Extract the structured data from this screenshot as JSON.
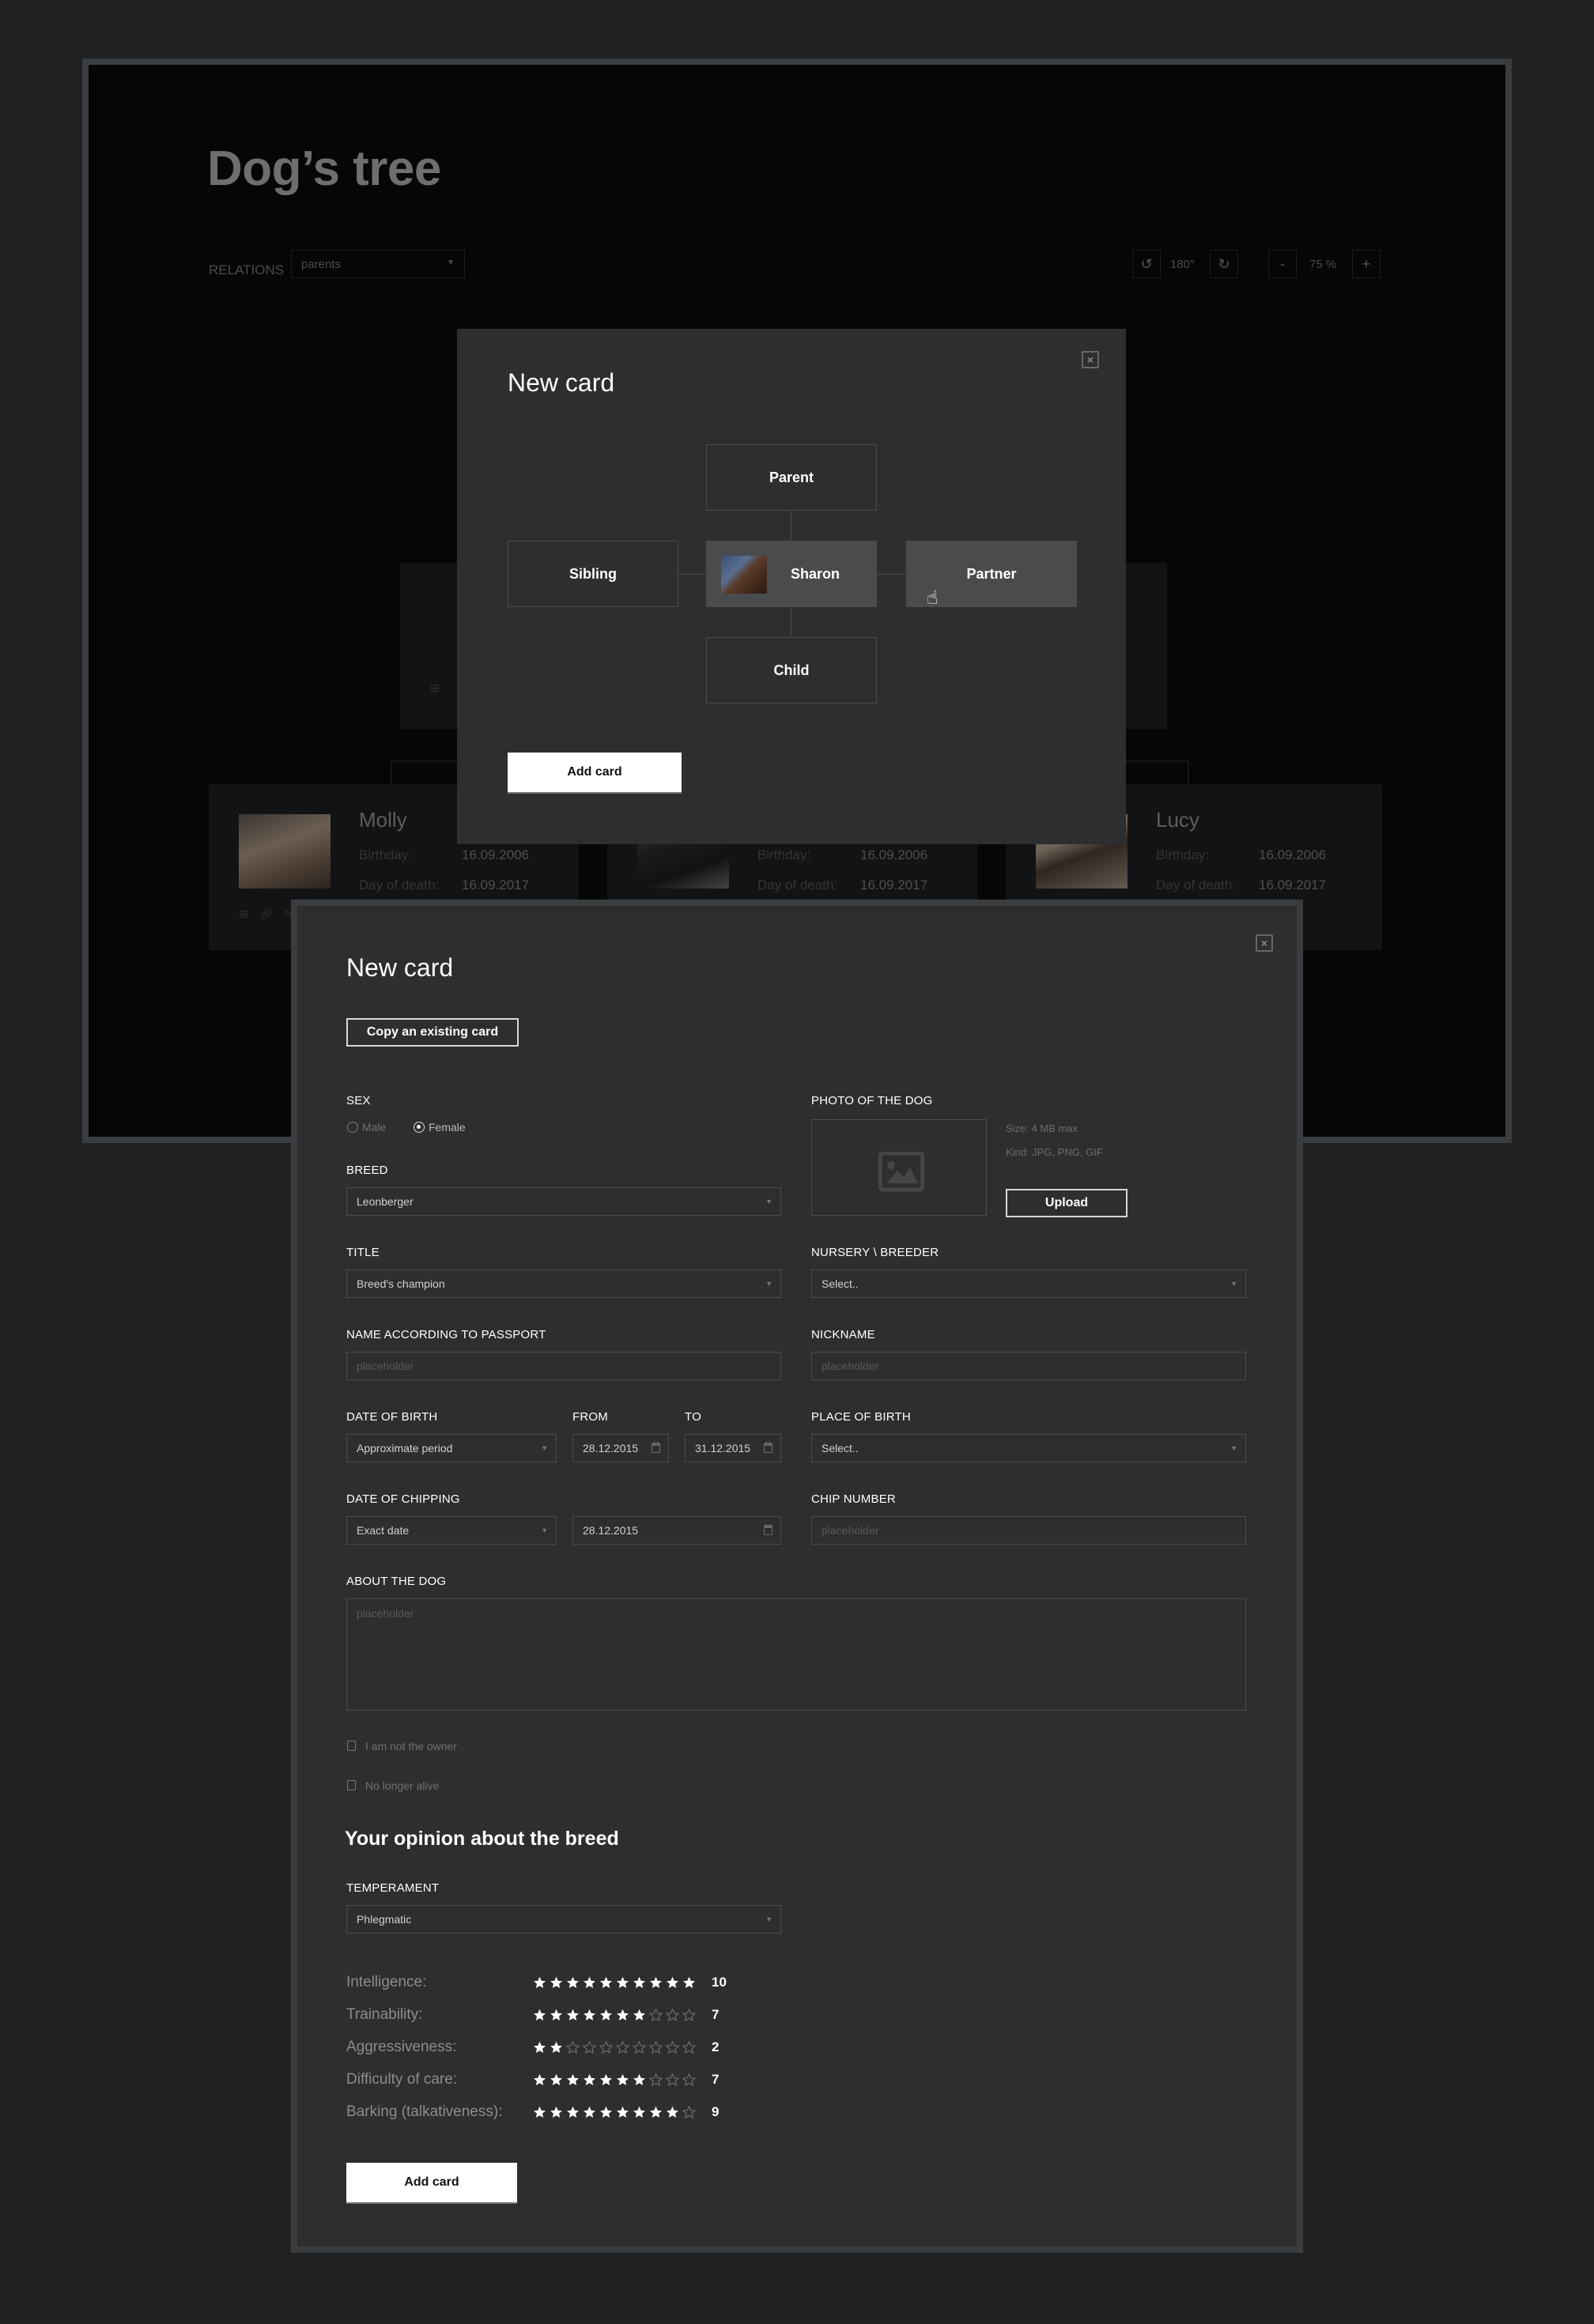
{
  "background_page": {
    "title": "Dog’s tree",
    "relations_label": "RELATIONS",
    "relations_value": "parents",
    "rotation_value": "180°",
    "zoom_value": "75 %",
    "rotate_left_icon": "↺",
    "rotate_right_icon": "↻",
    "zoom_out_label": "-",
    "zoom_in_label": "+",
    "cards": [
      {
        "name": "Molly",
        "birthday_label": "Birthday:",
        "birthday": "16.09.2006",
        "death_label": "Day of death:",
        "death": "16.09.2017"
      },
      {
        "name": "",
        "birthday_label": "Birthday:",
        "birthday": "16.09.2006",
        "death_label": "Day of death:",
        "death": "16.09.2017"
      },
      {
        "name": "Lucy",
        "birthday_label": "Birthday:",
        "birthday": "16.09.2006",
        "death_label": "Day of death:",
        "death": "16.09.2017"
      }
    ]
  },
  "relation_modal": {
    "title": "New card",
    "close_label": "×",
    "parent": "Parent",
    "sibling": "Sibling",
    "current": "Sharon",
    "partner": "Partner",
    "child": "Child",
    "add_button": "Add card"
  },
  "form_modal": {
    "title": "New card",
    "close_label": "×",
    "copy_button": "Copy an existing card",
    "sex": {
      "label": "SEX",
      "options": [
        "Male",
        "Female"
      ],
      "selected": "Female"
    },
    "photo": {
      "label": "PHOTO OF THE DOG",
      "size_hint": "Size: 4 MB max",
      "kind_hint": "Kind: JPG, PNG, GIF",
      "upload_button": "Upload"
    },
    "breed": {
      "label": "BREED",
      "value": "Leonberger"
    },
    "title_field": {
      "label": "TITLE",
      "value": "Breed's champion"
    },
    "nursery": {
      "label": "NURSERY \\ BREEDER",
      "value": "Select.."
    },
    "passport_name": {
      "label": "NAME ACCORDING TO PASSPORT",
      "placeholder": "placeholder"
    },
    "nickname": {
      "label": "NICKNAME",
      "placeholder": "placeholder"
    },
    "date_of_birth": {
      "label": "DATE OF BIRTH",
      "mode": "Approximate period",
      "from_label": "FROM",
      "from": "28.12.2015",
      "to_label": "TO",
      "to": "31.12.2015"
    },
    "place_of_birth": {
      "label": "PLACE OF BIRTH",
      "value": "Select.."
    },
    "date_of_chipping": {
      "label": "DATE OF CHIPPING",
      "mode": "Exact date",
      "date": "28.12.2015"
    },
    "chip_number": {
      "label": "CHIP NUMBER",
      "placeholder": "placeholder"
    },
    "about": {
      "label": "ABOUT THE DOG",
      "placeholder": "placeholder"
    },
    "not_owner": {
      "label": "I am not the owner",
      "checked": false
    },
    "not_alive": {
      "label": "No longer alive",
      "checked": false
    },
    "opinion_title": "Your opinion about the breed",
    "temperament": {
      "label": "TEMPERAMENT",
      "value": "Phlegmatic"
    },
    "ratings_max": 10,
    "ratings": [
      {
        "label": "Intelligence:",
        "value": 10
      },
      {
        "label": "Trainability:",
        "value": 7
      },
      {
        "label": "Aggressiveness:",
        "value": 2
      },
      {
        "label": "Difficulty of care:",
        "value": 7
      },
      {
        "label": "Barking (talkativeness):",
        "value": 9
      }
    ],
    "add_button": "Add card"
  }
}
